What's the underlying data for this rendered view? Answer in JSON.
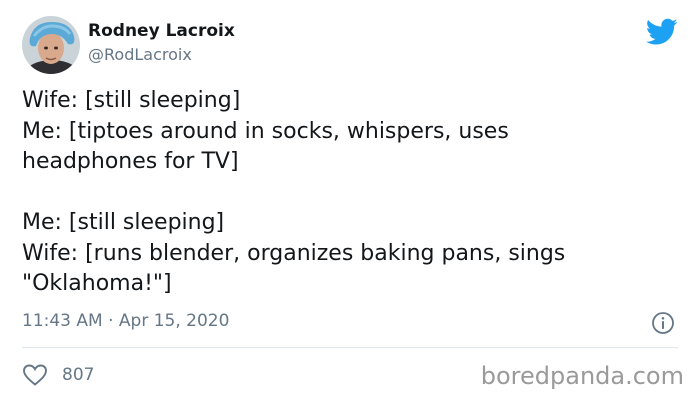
{
  "author": {
    "name": "Rodney Lacroix",
    "handle": "@RodLacroix"
  },
  "tweet": {
    "lines": [
      "Wife: [still sleeping]",
      "Me: [tiptoes around in socks, whispers, uses",
      "headphones for TV]",
      "Me: [still sleeping]",
      "Wife: [runs blender, organizes baking pans, sings",
      "\"Oklahoma!\"]"
    ],
    "timestamp": "11:43 AM · Apr 15, 2020"
  },
  "stats": {
    "likes": "807"
  },
  "watermark": "boredpanda.com",
  "icons": {
    "brand": "twitter-bird-icon",
    "info": "info-icon",
    "like": "heart-icon"
  },
  "colors": {
    "twitter_blue": "#1da1f2",
    "text_primary": "#14171a",
    "text_secondary": "#657786",
    "divider": "#e1e8ed"
  }
}
